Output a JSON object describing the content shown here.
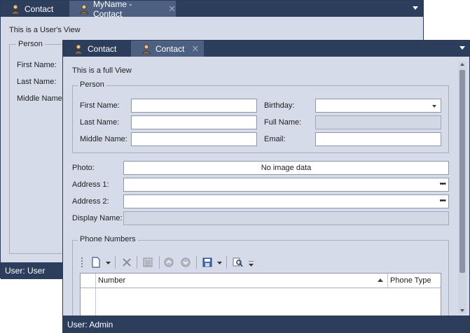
{
  "back_window": {
    "tabs": [
      {
        "label": "Contact",
        "icon": "user-icon",
        "closable": false
      },
      {
        "label": "MyName - Contact",
        "icon": "user-icon",
        "closable": true
      }
    ],
    "view_title": "This is a User's View",
    "group_title": "Person",
    "labels": {
      "first_name": "First Name:",
      "last_name": "Last Name:",
      "middle_name": "Middle Name:"
    },
    "status": "User: User"
  },
  "front_window": {
    "tabs": [
      {
        "label": "Contact",
        "icon": "user-icon",
        "closable": false
      },
      {
        "label": "Contact",
        "icon": "user-icon",
        "closable": true
      }
    ],
    "view_title": "This is a full View",
    "person": {
      "title": "Person",
      "first_name_label": "First Name:",
      "last_name_label": "Last Name:",
      "middle_name_label": "Middle Name:",
      "birthday_label": "Birthday:",
      "full_name_label": "Full Name:",
      "email_label": "Email:",
      "first_name_value": "",
      "last_name_value": "",
      "middle_name_value": "",
      "birthday_value": "",
      "full_name_value": "",
      "email_value": ""
    },
    "photo_label": "Photo:",
    "photo_value": "No image data",
    "address1_label": "Address 1:",
    "address2_label": "Address 2:",
    "display_name_label": "Display Name:",
    "phone_numbers": {
      "title": "Phone Numbers",
      "columns": [
        "Number",
        "Phone Type"
      ],
      "sorted_column": "Number",
      "rows": []
    },
    "status": "User: Admin"
  },
  "close_glyph": "✕",
  "ellipsis_glyph": "•••",
  "colors": {
    "chrome": "#2d3e5c",
    "active_tab": "#4d6082",
    "panel": "#d6dbe9"
  }
}
